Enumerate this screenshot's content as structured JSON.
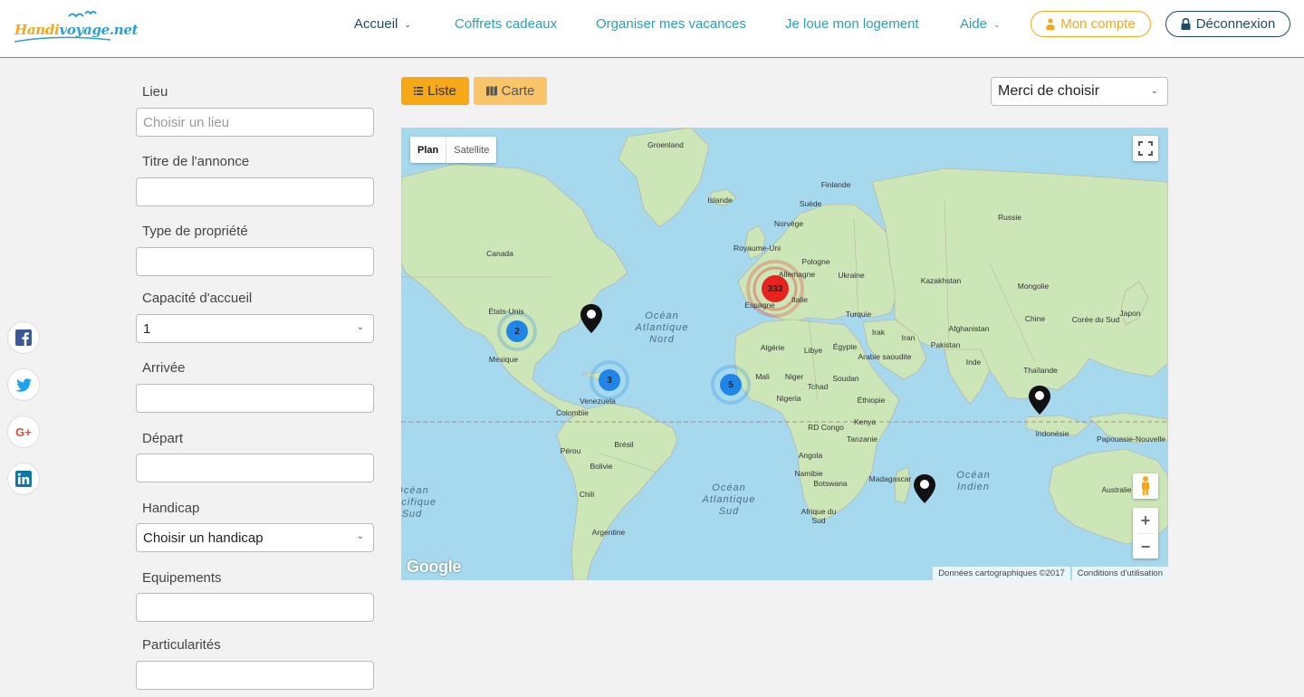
{
  "brand": {
    "logo_a": "Handi",
    "logo_b": "voyage.net"
  },
  "nav": {
    "accueil": "Accueil",
    "coffrets": "Coffrets cadeaux",
    "organiser": "Organiser mes vacances",
    "loue": "Je loue mon logement",
    "aide": "Aide",
    "compte": "Mon compte",
    "deconnexion": "Déconnexion"
  },
  "form": {
    "lieu": {
      "label": "Lieu",
      "placeholder": "Choisir un lieu"
    },
    "titre": {
      "label": "Titre de l'annonce"
    },
    "type": {
      "label": "Type de propriété"
    },
    "capacite": {
      "label": "Capacité d'accueil",
      "value": "1"
    },
    "arrivee": {
      "label": "Arrivée"
    },
    "depart": {
      "label": "Départ"
    },
    "handicap": {
      "label": "Handicap",
      "value": "Choisir un handicap"
    },
    "equipements": {
      "label": "Equipements"
    },
    "particularites": {
      "label": "Particularités"
    }
  },
  "toolbar": {
    "liste": "Liste",
    "carte": "Carte",
    "sort": "Merci de choisir"
  },
  "map": {
    "type_plan": "Plan",
    "type_satellite": "Satellite",
    "google": "Google",
    "attribution": "Données cartographiques ©2017",
    "terms": "Conditions d'utilisation",
    "labels": {
      "groenland": "Groenland",
      "islande": "Islande",
      "finlande": "Finlande",
      "suede": "Suède",
      "norvege": "Norvège",
      "russie": "Russie",
      "canada": "Canada",
      "royaume_uni": "Royaume-Uni",
      "pologne": "Pologne",
      "allemagne": "Allemagne",
      "ukraine": "Ukraine",
      "kazakhstan": "Kazakhstan",
      "mongolie": "Mongolie",
      "etats_unis": "États-Unis",
      "espagne": "Espagne",
      "italie": "Italie",
      "turquie": "Turquie",
      "chine": "Chine",
      "coree": "Corée du Sud",
      "japon": "Japon",
      "afghanistan": "Afghanistan",
      "irak": "Irak",
      "iran": "Iran",
      "pakistan": "Pakistan",
      "mexique": "Mexique",
      "algerie": "Algérie",
      "libye": "Libye",
      "egypte": "Égypte",
      "arabie": "Arabie saoudite",
      "inde": "Inde",
      "thailande": "Thaïlande",
      "mali": "Mali",
      "niger": "Niger",
      "soudan": "Soudan",
      "tchad": "Tchad",
      "venezuela": "Venezuela",
      "nigeria": "Nigeria",
      "ethiopie": "Éthiopie",
      "colombie": "Colombie",
      "rdcongo": "RD Congo",
      "kenya": "Kenya",
      "indonesie": "Indonésie",
      "papouasie": "Papouasie-Nouvelle",
      "perou": "Pérou",
      "bresil": "Brésil",
      "tanzanie": "Tanzanie",
      "bolivie": "Bolivie",
      "angola": "Angola",
      "namibie": "Namibie",
      "madagascar": "Madagascar",
      "chili": "Chili",
      "botswana": "Botswana",
      "australie": "Australie",
      "afrique_sud": "Afrique du Sud",
      "argentine": "Argentine"
    },
    "oceans": {
      "atl_nord": "Océan Atlantique Nord",
      "atl_sud": "Océan Atlantique Sud",
      "indien": "Océan Indien",
      "pacifique_sud": "Océan Pacifique Sud"
    },
    "clusters": {
      "c333": "333",
      "c2": "2",
      "c3": "3",
      "c5": "5"
    }
  },
  "colors": {
    "accent": "#f6a817",
    "teal": "#2a9fb8",
    "navy": "#1e4a66",
    "cluster_red": "#e8231f",
    "cluster_blue": "#1f86e8"
  }
}
